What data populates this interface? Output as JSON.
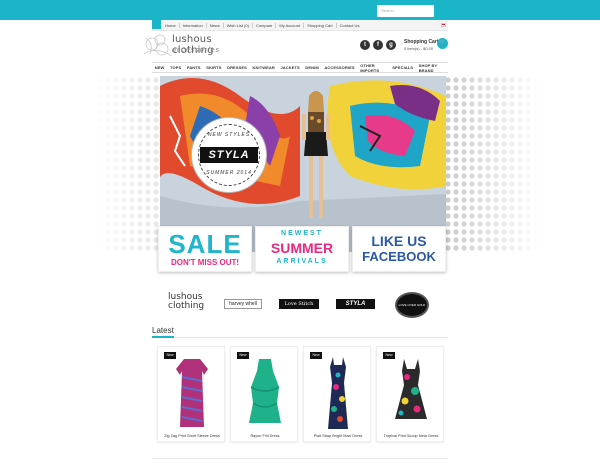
{
  "header": {
    "search_placeholder": "Search",
    "top_links": [
      "Home",
      "Information",
      "News",
      "Wish List (0)",
      "Compare",
      "My Account",
      "Shopping Cart",
      "Contact Us"
    ],
    "logo": {
      "main": "lushous clothing",
      "sub": "accessories"
    },
    "social": [
      {
        "icon": "twitter-icon",
        "glyph": "t"
      },
      {
        "icon": "facebook-icon",
        "glyph": "f"
      },
      {
        "icon": "googleplus-icon",
        "glyph": "g"
      }
    ],
    "cart": {
      "title": "Shopping Cart",
      "summary": "0 item(s) - $0.00"
    }
  },
  "nav": [
    "NEW",
    "TOPS",
    "PANTS",
    "SKIRTS",
    "DRESSES",
    "KNITWEAR",
    "JACKETS",
    "DENIM",
    "ACCESSORIES",
    "OTHER IMPORTS",
    "SPECIALS",
    "SHOP BY BRAND"
  ],
  "hero": {
    "badge": {
      "top": "NEW STYLES",
      "logo": "STYLA",
      "bottom": "SUMMER 2014"
    }
  },
  "promos": [
    {
      "big": "SALE",
      "small": "DON'T MISS OUT!"
    },
    {
      "top": "NEWEST",
      "mid": "SUMMER",
      "bot": "ARRIVALS"
    },
    {
      "top": "LIKE US",
      "bot": "FACEBOOK"
    }
  ],
  "brands": [
    "lushous clothing",
    "harvey whell",
    "Love Stitch",
    "STYLA",
    "LOVE OVER GOLD"
  ],
  "latest": {
    "title": "Latest",
    "badge_label": "New",
    "products": [
      {
        "name": "Zig Zag Print Short Sleeve Dress",
        "color": "#b0307a"
      },
      {
        "name": "Rayon Frill Dress",
        "color": "#1fb28a"
      },
      {
        "name": "Plait Strap Bright Maxi Dress",
        "color": "#1e2a55"
      },
      {
        "name": "Tropical Print Scoop Neck Dress",
        "color": "#2b2b2b"
      }
    ]
  },
  "colors": {
    "accent": "#1ab5c9",
    "pink": "#e8297d",
    "facebook": "#2a5aa6"
  }
}
